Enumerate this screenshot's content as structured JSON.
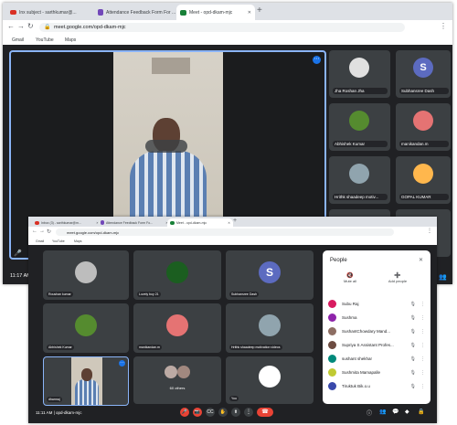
{
  "back": {
    "tabs": [
      {
        "label": "Inx subject - sarthkumar@...",
        "color": "#d93025"
      },
      {
        "label": "Attendance Feedback Form For ...",
        "color": "#7248b9"
      },
      {
        "label": "Meet - opd-dkam-mjc",
        "color": "#188038"
      }
    ],
    "url": "meet.google.com/opd-dkam-mjc",
    "bookmarks": [
      "Gmail",
      "YouTube",
      "Maps"
    ],
    "participants": [
      {
        "name": "Jha Roshan Jha"
      },
      {
        "name": "Subhansree Dash",
        "initial": "S"
      },
      {
        "name": "Abhishek Kumar"
      },
      {
        "name": "manikandan.m"
      },
      {
        "name": "Hrithk shaadeep motiv..."
      },
      {
        "name": "GOPAL KUMAR"
      }
    ],
    "time": "11:17 AM",
    "meeting_code": "opd-dkam-mjc"
  },
  "front": {
    "tabs": [
      {
        "label": "Inbox (3) - sarthkumar@m...",
        "color": "#d93025"
      },
      {
        "label": "Attendance Feedback Form Fo...",
        "color": "#7248b9"
      },
      {
        "label": "Meet - opd-dkam-mjc",
        "color": "#188038"
      }
    ],
    "url": "meet.google.com/opd-dkam-mjc",
    "bookmarks": [
      "Gmail",
      "YouTube",
      "Maps"
    ],
    "tiles": [
      {
        "name": "Roushan kumar"
      },
      {
        "name": "Lovely boy 21"
      },
      {
        "name": "Subhansree Dash",
        "initial": "S"
      },
      {
        "name": "Abhishek Kumar"
      },
      {
        "name": "manikandan.m"
      },
      {
        "name": "Hrithk shaadeep motivation videos"
      },
      {
        "name": "dharmaj"
      },
      {
        "name": "60 others"
      },
      {
        "name": "You"
      }
    ],
    "panel": {
      "title": "People",
      "mute_all": "Mute all",
      "add_people": "Add people",
      "people": [
        {
          "name": "Subu Raj",
          "color": "#d81b60"
        },
        {
          "name": "Sushma",
          "color": "#8e24aa"
        },
        {
          "name": "SushantChowdary Mand...",
          "color": "#8d6e63"
        },
        {
          "name": "Supriya S Assistant Profes...",
          "color": "#6d4c41"
        },
        {
          "name": "sushant shekhar",
          "color": "#00897b"
        },
        {
          "name": "Sushmita Mamapalle",
          "color": "#c0ca33"
        },
        {
          "name": "Tiruktuk Bik.o.u",
          "color": "#3949ab"
        }
      ]
    },
    "time": "11:11 AM",
    "meeting_code": "opd-dkam-mjc"
  }
}
